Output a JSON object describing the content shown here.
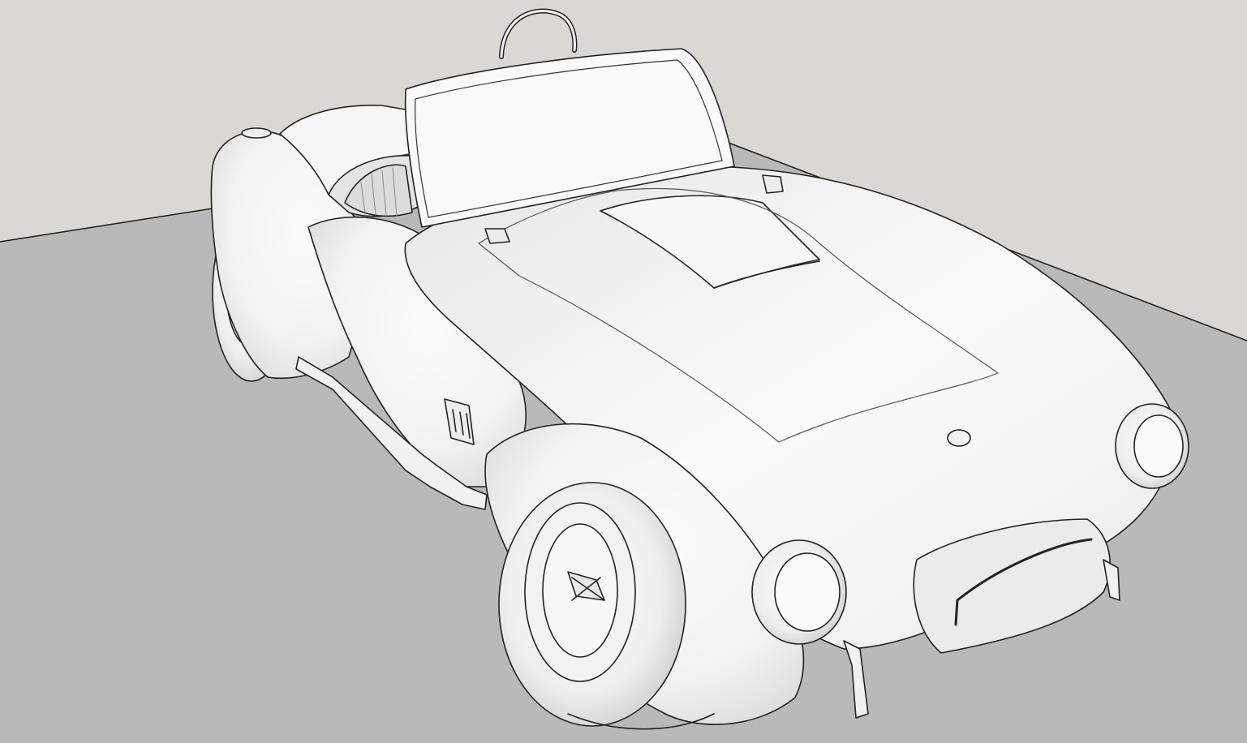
{
  "viewport": {
    "type": "3d-model-viewport",
    "model": "sports-roadster-convertible",
    "render_style": "monochrome-shaded-with-edges",
    "colors": {
      "sky": "#d9d8d3",
      "ground": "#b9b9b9",
      "body": "#f2f2f2",
      "shadow": "#c8c8c8",
      "edge": "#1a1a1a"
    }
  }
}
